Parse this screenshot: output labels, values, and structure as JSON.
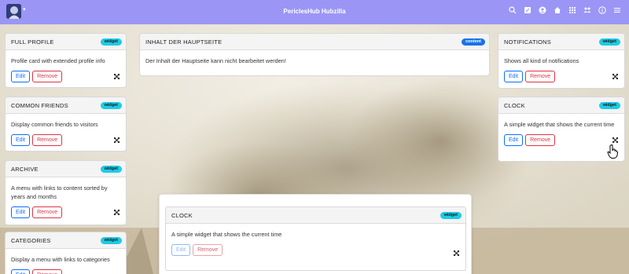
{
  "navbar": {
    "title": "PericlesHub Hubzilla",
    "caret": "▾",
    "icons": [
      "search-icon",
      "pencil-square-icon",
      "person-circle-icon",
      "home-icon",
      "apps-grid-icon",
      "people-icon",
      "info-icon",
      "menu-icon"
    ]
  },
  "colors": {
    "navbar": "#9b96f5",
    "widget_badge": "#1ecbe6",
    "content_badge": "#1a73e8",
    "edit": "#0d6efd",
    "remove": "#dc3545"
  },
  "buttons": {
    "edit": "Edit",
    "remove": "Remove"
  },
  "left_column": [
    {
      "title": "FULL PROFILE",
      "badge": "widget",
      "description": "Profile card with extended profile info"
    },
    {
      "title": "COMMON FRIENDS",
      "badge": "widget",
      "description": "Display common friends to visitors"
    },
    {
      "title": "ARCHIVE",
      "badge": "widget",
      "description": "A menu with links to content sorted by years and months"
    },
    {
      "title": "CATEGORIES",
      "badge": "widget",
      "description": "Display a menu with links to categories"
    }
  ],
  "main": {
    "title": "INHALT DER HAUPTSEITE",
    "badge": "content",
    "description": "Der Inhalt der Hauptseite kann nicht bearbeitet werden!"
  },
  "right_column": [
    {
      "title": "NOTIFICATIONS",
      "badge": "widget",
      "description": "Shows all kind of notifications"
    },
    {
      "title": "CLOCK",
      "badge": "widget",
      "description": "A simple widget that shows the current time"
    }
  ],
  "dragging": {
    "title": "CLOCK",
    "badge": "widget",
    "description": "A simple widget that shows the current time",
    "close": "×"
  }
}
